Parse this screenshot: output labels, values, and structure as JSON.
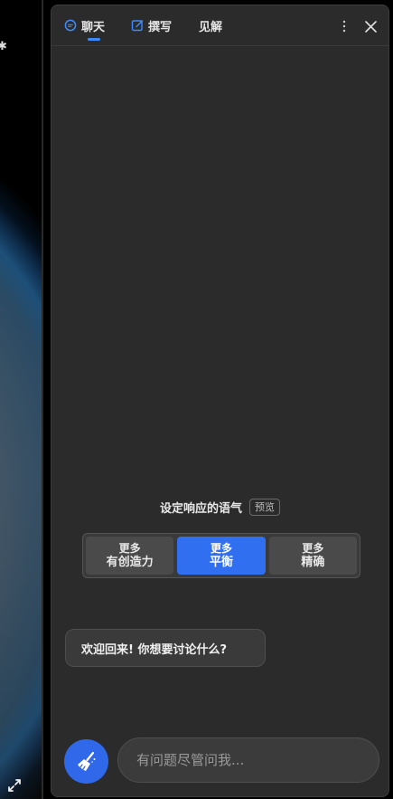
{
  "tabs": [
    {
      "label": "聊天",
      "icon": "chat-icon",
      "active": true
    },
    {
      "label": "撰写",
      "icon": "compose-icon",
      "active": false
    },
    {
      "label": "见解",
      "icon": "",
      "active": false
    }
  ],
  "header": {
    "more_icon": "more-vertical-icon",
    "close_icon": "close-icon"
  },
  "tone": {
    "title": "设定响应的语气",
    "badge": "预览",
    "options": [
      {
        "line1": "更多",
        "line2": "有创造力",
        "active": false
      },
      {
        "line1": "更多",
        "line2": "平衡",
        "active": true
      },
      {
        "line1": "更多",
        "line2": "精确",
        "active": false
      }
    ]
  },
  "welcome_message": "欢迎回来! 你想要讨论什么?",
  "input": {
    "placeholder": "有问题尽管问我..."
  },
  "colors": {
    "accent": "#2f6ff0",
    "panel": "#2b2b2b"
  }
}
